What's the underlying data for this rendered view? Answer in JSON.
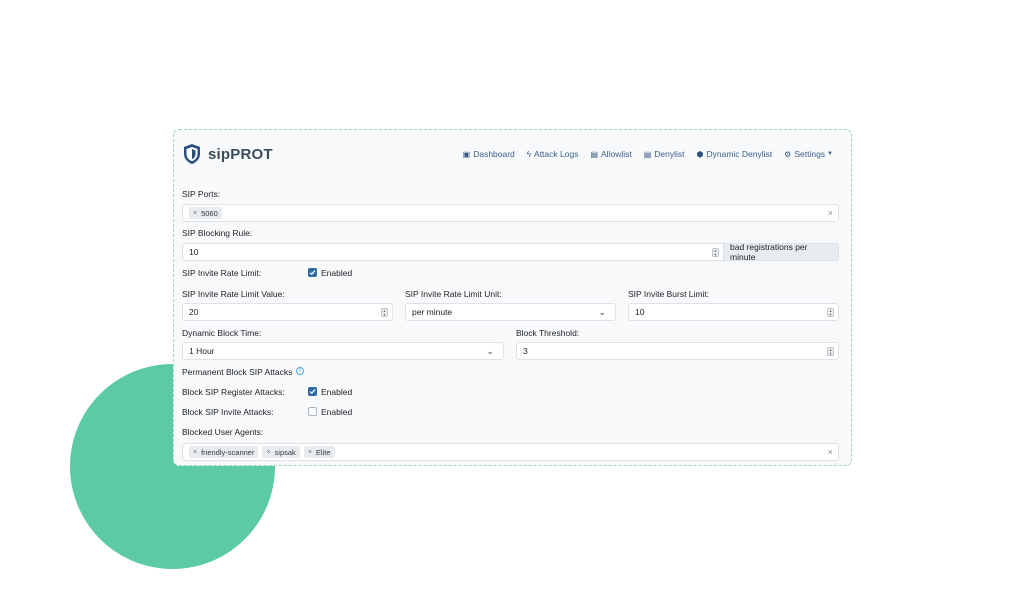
{
  "brand": {
    "name": "sipPROT"
  },
  "nav": [
    {
      "label": "Dashboard",
      "icon": "dashboard-icon"
    },
    {
      "label": "Attack Logs",
      "icon": "bolt-icon"
    },
    {
      "label": "Allowlist",
      "icon": "document-icon"
    },
    {
      "label": "Denylist",
      "icon": "document-icon"
    },
    {
      "label": "Dynamic Denylist",
      "icon": "hexagon-icon"
    },
    {
      "label": "Settings",
      "icon": "gear-icon"
    }
  ],
  "form": {
    "sip_ports": {
      "label": "SIP Ports:",
      "tags": [
        "5060"
      ]
    },
    "blocking_rule": {
      "label": "SIP Blocking Rule:",
      "value": "10",
      "addon": "bad registrations per minute"
    },
    "invite_rate_limit": {
      "label": "SIP Invite Rate Limit:",
      "checked": true,
      "check_label": "Enabled"
    },
    "invite_rate_value": {
      "label": "SIP Invite Rate Limit Value:",
      "value": "20"
    },
    "invite_rate_unit": {
      "label": "SIP Invite Rate Limit Unit:",
      "value": "per minute"
    },
    "invite_burst": {
      "label": "SIP Invite Burst Limit:",
      "value": "10"
    },
    "dynamic_block_time": {
      "label": "Dynamic Block Time:",
      "value": "1 Hour"
    },
    "block_threshold": {
      "label": "Block Threshold:",
      "value": "3"
    },
    "permanent_block": {
      "label": "Permanent Block SIP Attacks",
      "info": "i"
    },
    "block_register": {
      "label": "Block SIP Register Attacks:",
      "checked": true,
      "check_label": "Enabled"
    },
    "block_invite": {
      "label": "Block SIP Invite Attacks:",
      "checked": false,
      "check_label": "Enabled"
    },
    "blocked_agents": {
      "label": "Blocked User Agents:",
      "tags": [
        "friendly-scanner",
        "sipsak",
        "Elite"
      ]
    }
  },
  "colors": {
    "accent": "#2f6aa6",
    "decor_circle": "#5ccaa3",
    "nav_link": "#3b5f8c"
  }
}
